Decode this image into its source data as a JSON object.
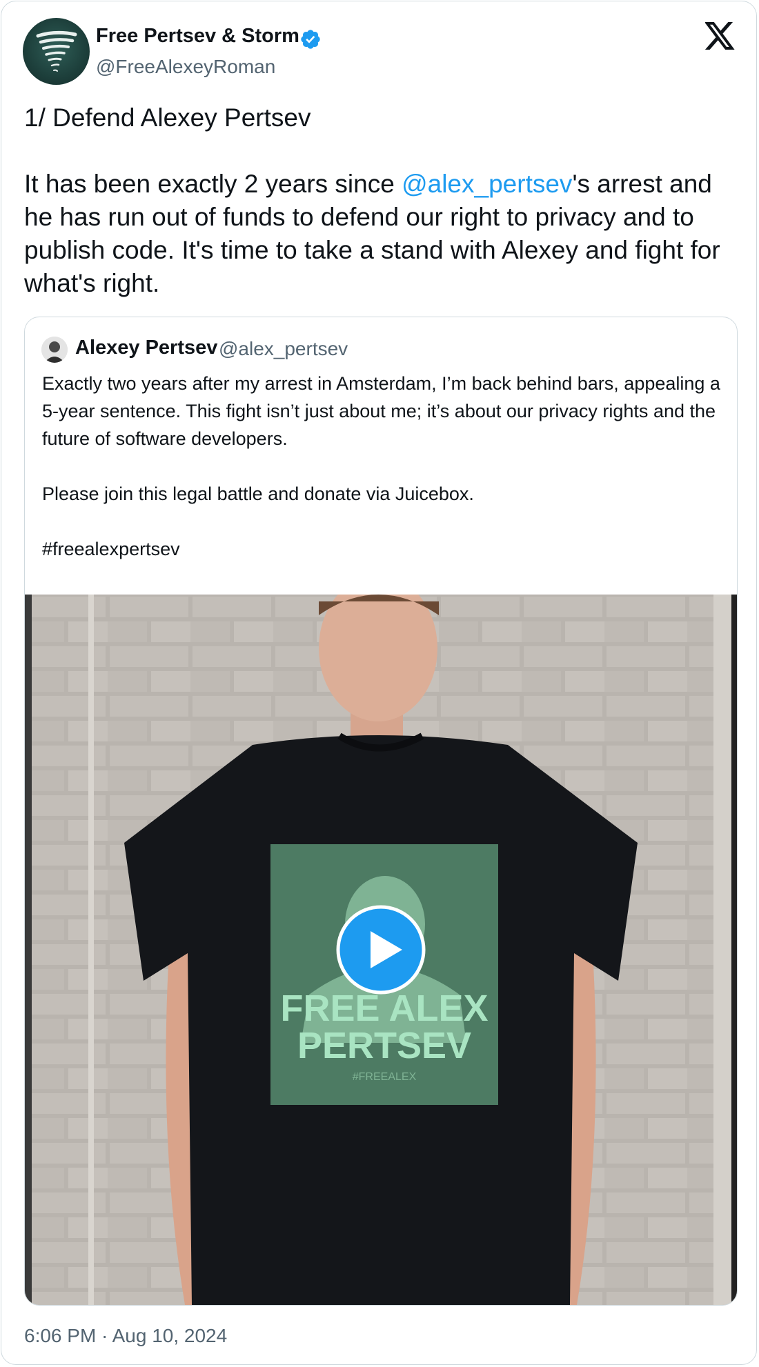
{
  "tweet": {
    "author_name": "Free Pertsev & Storm",
    "author_handle": "@FreeAlexeyRoman",
    "heading": "1/ Defend Alexey Pertsev",
    "body_pre": "It has been exactly 2 years since ",
    "mention": "@alex_pertsev",
    "body_post": "'s arrest and he has run out of funds to defend our right to privacy and to publish code. It's time to take a stand with Alexey and fight for what's right.",
    "timestamp": "6:06 PM · Aug 10, 2024"
  },
  "quote": {
    "author_name": "Alexey Pertsev",
    "author_handle": "@alex_pertsev",
    "paragraph1": "Exactly two years after my arrest in Amsterdam, I’m back behind bars, appealing a 5-year sentence. This fight isn’t just about me; it’s about our privacy rights and the future of software developers.",
    "paragraph2": "Please join this legal battle and donate via Juicebox.",
    "hashtag": "#freealexpertsev",
    "video": {
      "shirt_line1": "FREE ALEX",
      "shirt_line2": "PERTSEV",
      "shirt_tag": "#FREEALEX"
    }
  },
  "colors": {
    "accent": "#1d9bf0",
    "secondary_text": "#536471",
    "border": "#cfd9de"
  },
  "icons": [
    "verified-badge-icon",
    "x-logo-icon",
    "play-icon"
  ]
}
